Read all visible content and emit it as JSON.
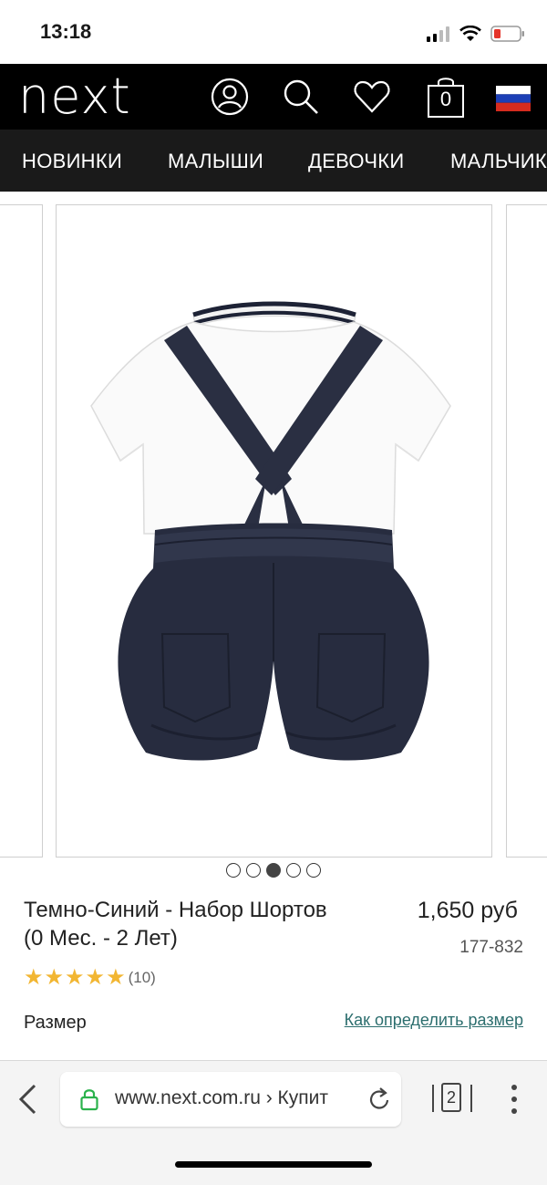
{
  "status": {
    "time": "13:18"
  },
  "header": {
    "logo": "next",
    "bag_count": "0"
  },
  "nav": {
    "items": [
      "НОВИНКИ",
      "МАЛЫШИ",
      "ДЕВОЧКИ",
      "МАЛЬЧИКИ"
    ]
  },
  "gallery": {
    "total": 5,
    "active_index": 2
  },
  "product": {
    "title": "Темно-Синий - Набор Шортов (0 Мес. - 2 Лет)",
    "price": "1,650 руб",
    "sku": "177-832",
    "rating_stars": 5,
    "review_count": "(10)",
    "size_label": "Размер",
    "size_guide": "Как определить размер"
  },
  "browser": {
    "url": "www.next.com.ru › Купит",
    "tab_count": "2"
  },
  "colors": {
    "header_bg": "#000000",
    "nav_bg": "#1a1a1a",
    "star": "#f2b632",
    "link": "#2c6e6e"
  }
}
